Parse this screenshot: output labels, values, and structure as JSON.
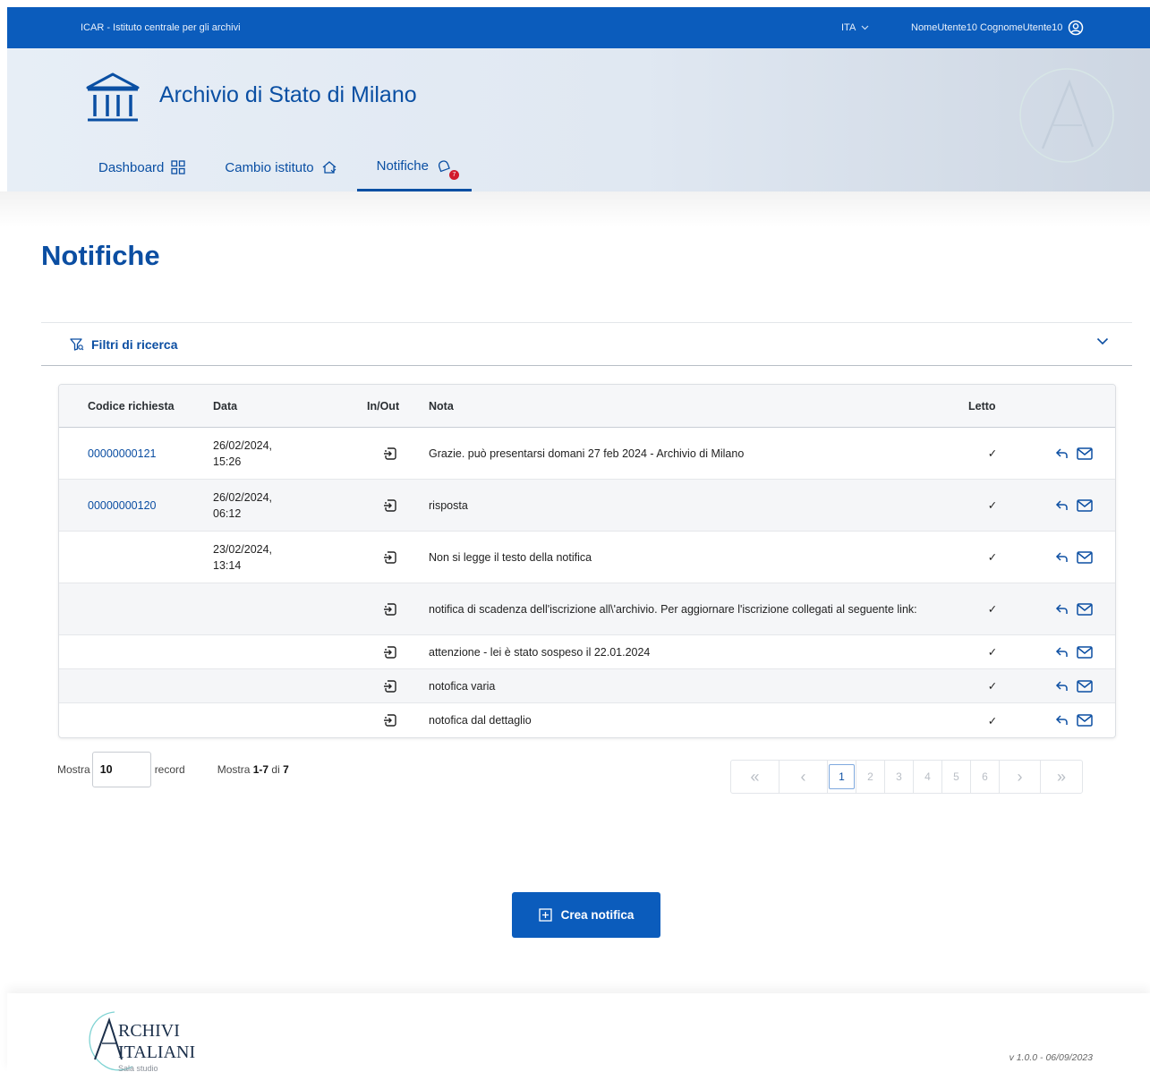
{
  "topbar": {
    "org": "ICAR - Istituto centrale per gli archivi",
    "lang": "ITA",
    "user": "NomeUtente10 CognomeUtente10"
  },
  "header": {
    "title": "Archivio di Stato di Milano",
    "nav": [
      {
        "label": "Dashboard"
      },
      {
        "label": "Cambio istituto"
      },
      {
        "label": "Notifiche",
        "badge": "7"
      }
    ]
  },
  "page": {
    "title": "Notifiche"
  },
  "filter": {
    "label": "Filtri di ricerca"
  },
  "table": {
    "headers": {
      "code": "Codice richiesta",
      "date": "Data",
      "io": "In/Out",
      "note": "Nota",
      "read": "Letto"
    },
    "rows": [
      {
        "code": "00000000121",
        "date1": "26/02/2024,",
        "date2": "15:26",
        "note": "Grazie. può presentarsi domani 27 feb 2024 - Archivio di Milano",
        "read": "✓"
      },
      {
        "code": "00000000120",
        "date1": "26/02/2024,",
        "date2": "06:12",
        "note": "risposta",
        "read": "✓"
      },
      {
        "code": "",
        "date1": "23/02/2024,",
        "date2": "13:14",
        "note": "Non si legge il testo della notifica",
        "read": "✓"
      },
      {
        "code": "",
        "date1": "",
        "date2": "",
        "note": "notifica di scadenza dell'iscrizione all\\'archivio. Per aggiornare l'iscrizione collegati al seguente link:",
        "read": "✓"
      },
      {
        "code": "",
        "date1": "",
        "date2": "",
        "note": "attenzione - lei è stato sospeso il 22.01.2024",
        "read": "✓"
      },
      {
        "code": "",
        "date1": "",
        "date2": "",
        "note": "notofica varia",
        "read": "✓"
      },
      {
        "code": "",
        "date1": "",
        "date2": "",
        "note": "notofica dal dettaglio",
        "read": "✓"
      }
    ]
  },
  "pagination": {
    "show_label": "Mostra",
    "show_value": "10",
    "record_label": "record",
    "summary_prefix": "Mostra",
    "summary_range": "1-7",
    "summary_of": "di",
    "summary_total": "7",
    "first": "«",
    "prev": "‹",
    "next": "›",
    "last": "»",
    "pages": [
      "1",
      "2",
      "3",
      "4",
      "5",
      "6"
    ],
    "current": "1"
  },
  "actions": {
    "create_label": "Crea notifica"
  },
  "footer": {
    "logo_line1": "RCHIVI",
    "logo_line2": "ITALIANI",
    "logo_sub": "Sala studio",
    "version": "v 1.0.0 - 06/09/2023"
  },
  "colors": {
    "primary": "#0b5cbc",
    "title": "#0b4ea2",
    "badge": "#d21c2c"
  }
}
